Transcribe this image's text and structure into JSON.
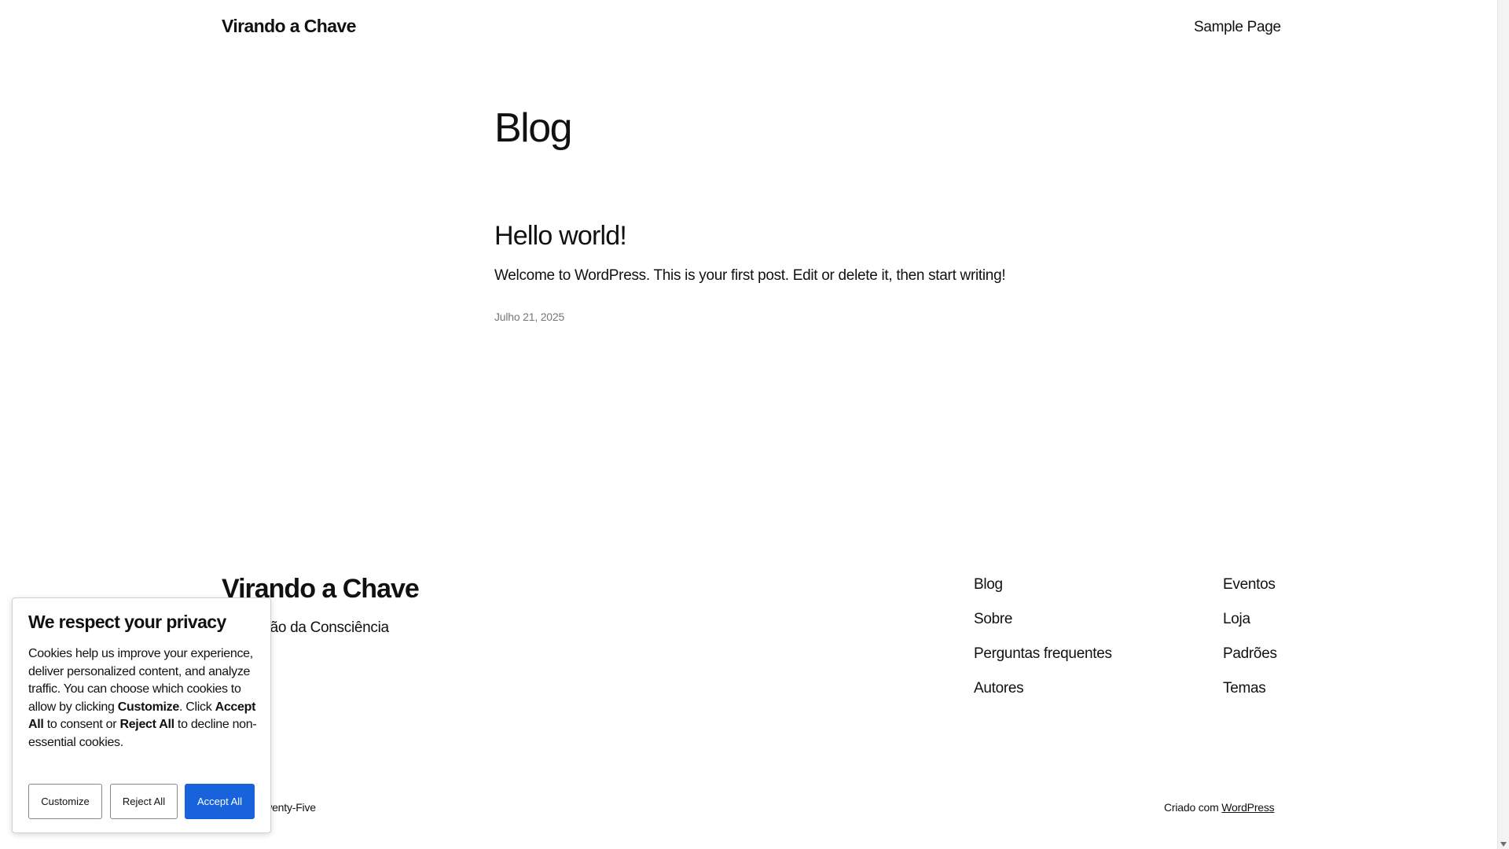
{
  "header": {
    "site_title": "Virando a Chave",
    "nav": [
      "Sample Page"
    ]
  },
  "main": {
    "heading": "Blog",
    "posts": [
      {
        "title": "Hello world!",
        "excerpt": "Welcome to WordPress. This is your first post. Edit or delete it, then start writing!",
        "date": "Julho 21, 2025"
      }
    ]
  },
  "footer": {
    "site_title": "Virando a Chave",
    "tagline": "Expansão da Consciência",
    "nav_col_1": [
      "Blog",
      "Sobre",
      "Perguntas frequentes",
      "Autores"
    ],
    "nav_col_2": [
      "Eventos",
      "Loja",
      "Padrões",
      "Temas"
    ],
    "theme_text": "Twenty Twenty-Five",
    "credit_prefix": "Criado com ",
    "credit_link": "WordPress"
  },
  "cookie_banner": {
    "title": "We respect your privacy",
    "body_1": "Cookies help us improve your experience, deliver personalized content, and analyze traffic. You can choose which cookies to allow by clicking ",
    "body_bold_1": "Customize",
    "body_2": ". Click ",
    "body_bold_2": "Accept All",
    "body_3": " to consent or ",
    "body_bold_3": "Reject All",
    "body_4": " to decline non-essential cookies.",
    "buttons": {
      "customize": "Customize",
      "reject": "Reject All",
      "accept": "Accept All"
    },
    "accent_color": "#1863dc"
  }
}
